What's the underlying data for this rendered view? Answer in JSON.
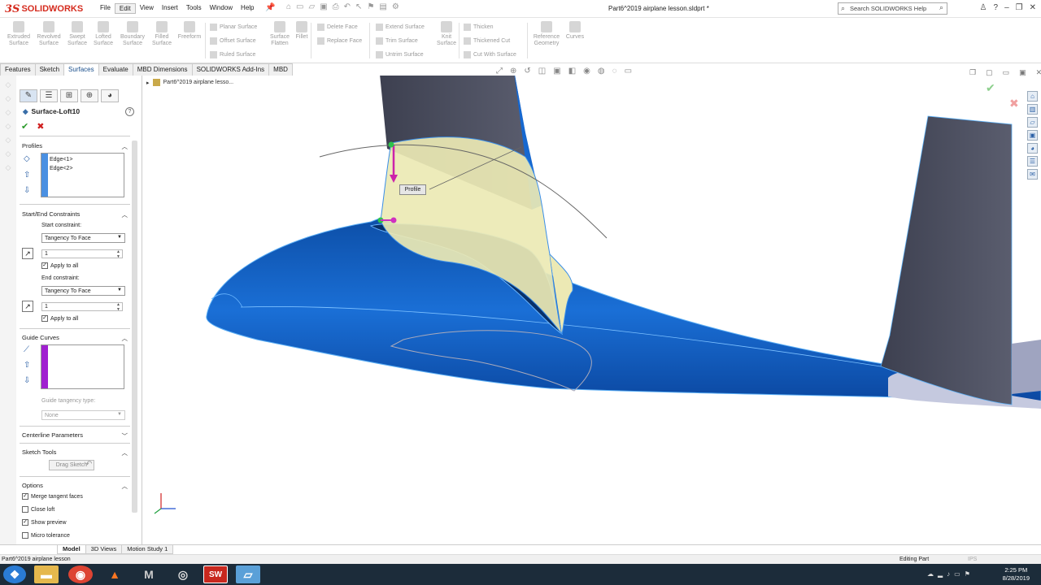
{
  "app": {
    "brand": "SOLIDWORKS",
    "doc_title": "Part6^2019 airplane lesson.sldprt *",
    "search_placeholder": "Search SOLIDWORKS Help"
  },
  "menu": [
    "File",
    "Edit",
    "View",
    "Insert",
    "Tools",
    "Window",
    "Help"
  ],
  "ribbon": {
    "large": [
      {
        "l1": "Extruded",
        "l2": "Surface"
      },
      {
        "l1": "Revolved",
        "l2": "Surface"
      },
      {
        "l1": "Swept",
        "l2": "Surface"
      },
      {
        "l1": "Lofted",
        "l2": "Surface"
      },
      {
        "l1": "Boundary",
        "l2": "Surface"
      },
      {
        "l1": "Filled",
        "l2": "Surface"
      },
      {
        "l1": "Freeform",
        "l2": ""
      }
    ],
    "group1": [
      "Planar Surface",
      "Offset Surface",
      "Ruled Surface"
    ],
    "flatten": {
      "l1": "Surface",
      "l2": "Flatten"
    },
    "fillet": "Fillet",
    "group2": [
      "Delete Face",
      "Replace Face"
    ],
    "group3": [
      "Extend Surface",
      "Trim Surface",
      "Untrim Surface"
    ],
    "knit": {
      "l1": "Knit",
      "l2": "Surface"
    },
    "group4": [
      "Thicken",
      "Thickened Cut",
      "Cut With Surface"
    ],
    "refgeo": {
      "l1": "Reference",
      "l2": "Geometry"
    },
    "curves": "Curves"
  },
  "tabs": [
    "Features",
    "Sketch",
    "Surfaces",
    "Evaluate",
    "MBD Dimensions",
    "SOLIDWORKS Add-Ins",
    "MBD"
  ],
  "tree_root": "Part6^2019 airplane lesso...",
  "property": {
    "feature_name": "Surface-Loft10",
    "profiles_title": "Profiles",
    "profiles": [
      "Edge<1>",
      "Edge<2>"
    ],
    "constraints_title": "Start/End Constraints",
    "start_label": "Start constraint:",
    "start_value": "Tangency To Face",
    "start_length": "1",
    "apply_all": "Apply to all",
    "end_label": "End constraint:",
    "end_value": "Tangency To Face",
    "end_length": "1",
    "guide_title": "Guide Curves",
    "guide_tangency_label": "Guide tangency type:",
    "guide_tangency_value": "None",
    "centerline_title": "Centerline Parameters",
    "sketch_tools_title": "Sketch Tools",
    "drag_sketch": "Drag Sketch",
    "options_title": "Options",
    "opt_merge": "Merge tangent faces",
    "opt_close": "Close loft",
    "opt_preview": "Show preview",
    "opt_micro": "Micro tolerance"
  },
  "callout": "Profile",
  "bottom_tabs": [
    "Model",
    "3D Views",
    "Motion Study 1"
  ],
  "status": {
    "left": "Part6^2019 airplane lesson",
    "mode": "Editing Part",
    "units": "IPS"
  },
  "clock": {
    "time": "2:25 PM",
    "date": "8/28/2019"
  },
  "colors": {
    "fuselage": "#1565c8",
    "loft_preview": "#ece9b4",
    "tail": "#4a4d5c",
    "accent": "#d52b1e"
  }
}
